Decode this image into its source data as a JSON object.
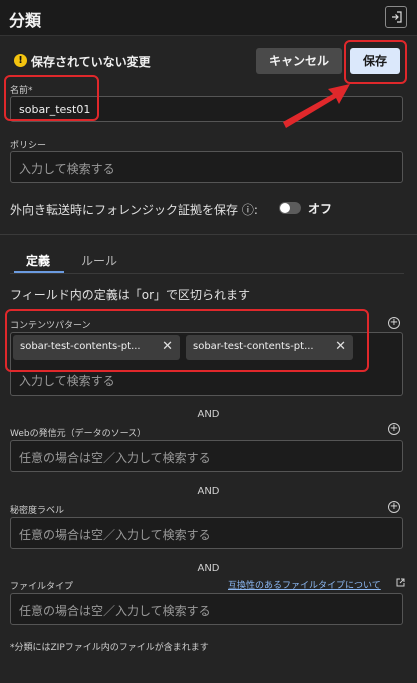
{
  "header": {
    "title": "分類",
    "exit_icon": "panel-exit-icon"
  },
  "status": {
    "unsaved_text": "保存されていない変更",
    "warn_icon": "!"
  },
  "actions": {
    "cancel_label": "キャンセル",
    "save_label": "保存"
  },
  "name": {
    "label": "名前",
    "required_mark": "*",
    "value": "sobar_test01"
  },
  "policy": {
    "label": "ポリシー",
    "placeholder": "入力して検索する"
  },
  "forensic": {
    "text": "外向き転送時にフォレンジック証拠を保存",
    "info_icon": "ⓘ",
    "colon": ":",
    "toggle_label": "オフ"
  },
  "tabs": {
    "definition": "定義",
    "rule": "ルール"
  },
  "hint": "フィールド内の定義は「or」で区切られます",
  "content_pattern": {
    "label": "コンテンツパターン",
    "chips": [
      {
        "text": "sobar-test-contents-pt..."
      },
      {
        "text": "sobar-test-contents-pt..."
      }
    ],
    "placeholder": "入力して検索する"
  },
  "and_text": "AND",
  "web_source": {
    "label": "Webの発信元（データのソース）",
    "placeholder": "任意の場合は空／入力して検索する"
  },
  "sensitivity": {
    "label": "秘密度ラベル",
    "placeholder": "任意の場合は空／入力して検索する"
  },
  "file_type": {
    "label": "ファイルタイプ",
    "link": "互換性のあるファイルタイプについて",
    "placeholder": "任意の場合は空／入力して検索する"
  },
  "footnote": "*分類にはZIPファイル内のファイルが含まれます",
  "colors": {
    "accent": "#6b9be0",
    "save_bg": "#dbe8fb",
    "annotation": "#e0282b",
    "warning": "#f4c40f"
  }
}
